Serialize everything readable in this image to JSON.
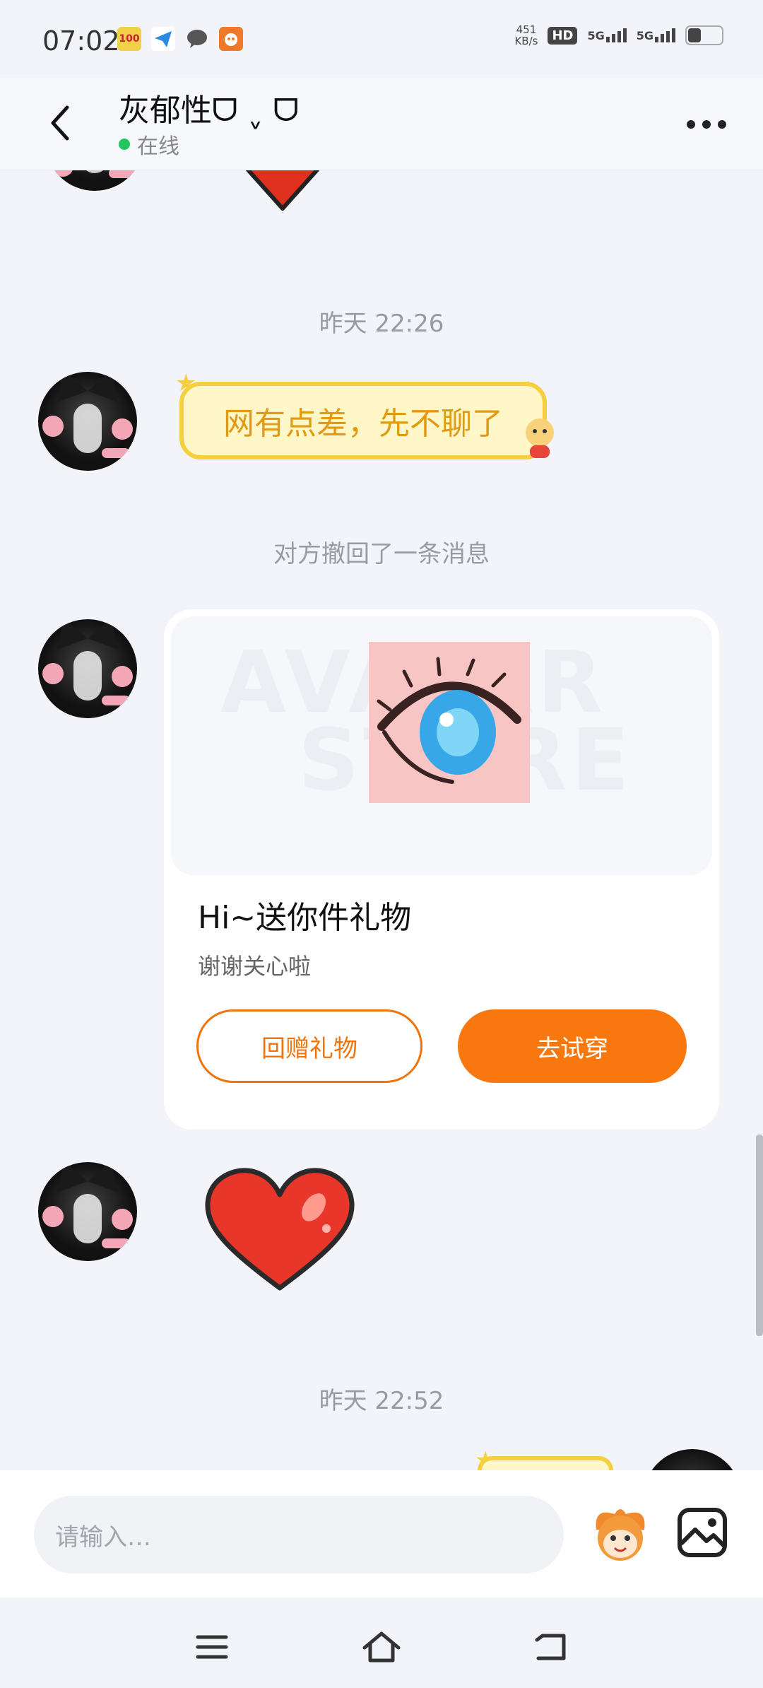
{
  "status_bar": {
    "time": "07:02",
    "net_speed_value": "451",
    "net_speed_unit": "KB/s",
    "hd_label": "HD",
    "sim1_label": "5G",
    "sim2_label": "5G"
  },
  "header": {
    "title": "灰郁性ᗜ ˬ ᗜ",
    "status": "在线"
  },
  "messages": {
    "timestamp_1": "昨天 22:26",
    "sticker_text": "网有点差，先不聊了",
    "recall_notice": "对方撤回了一条消息",
    "gift_card": {
      "watermark_line1": "AVATAR",
      "watermark_line2": "STORE",
      "title": "Hi~送你件礼物",
      "subtitle": "谢谢关心啦",
      "return_gift_label": "回赠礼物",
      "try_on_label": "去试穿"
    },
    "timestamp_2": "昨天 22:52"
  },
  "input": {
    "placeholder": "请输入…"
  },
  "colors": {
    "accent_orange": "#f8780f",
    "online_green": "#22c55e",
    "sticker_yellow": "#f6cf3e"
  }
}
